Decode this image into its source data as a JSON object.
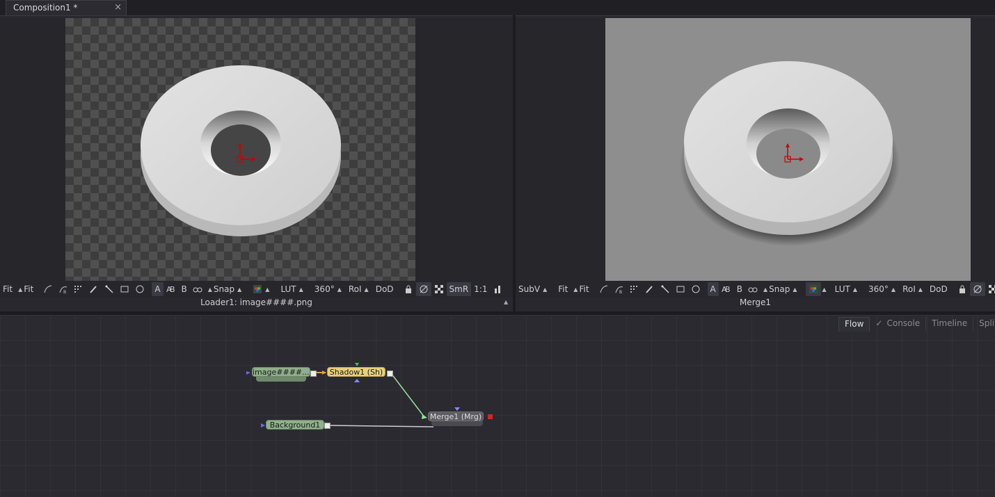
{
  "tabs": [
    {
      "label": "Composition1 *",
      "close": "×"
    }
  ],
  "viewer_left": {
    "toolbar": [
      "Fit",
      "Fit",
      "A",
      "B",
      "Snap",
      "LUT",
      "360°",
      "RoI",
      "DoD",
      "SmR",
      "1:1"
    ],
    "name": "Loader1: image####.png"
  },
  "viewer_right": {
    "toolbar": [
      "SubV",
      "Fit",
      "Fit",
      "A",
      "B",
      "Snap",
      "LUT",
      "360°",
      "RoI",
      "DoD"
    ],
    "name": "Merge1"
  },
  "panel_tabs": [
    "Flow",
    "Console",
    "Timeline",
    "Splin"
  ],
  "nodes": {
    "loader": "image####....",
    "shadow": "Shadow1  (Sh)",
    "background": "Background1",
    "merge": "Merge1  (Mrg)"
  },
  "colors": {
    "loader": "#8fb08a",
    "shadow": "#e8d07a",
    "merge": "#5c5c62",
    "checker_dark": "#3d3d3d",
    "checker_light": "#505050",
    "view_bg": "#8e8e8e"
  }
}
